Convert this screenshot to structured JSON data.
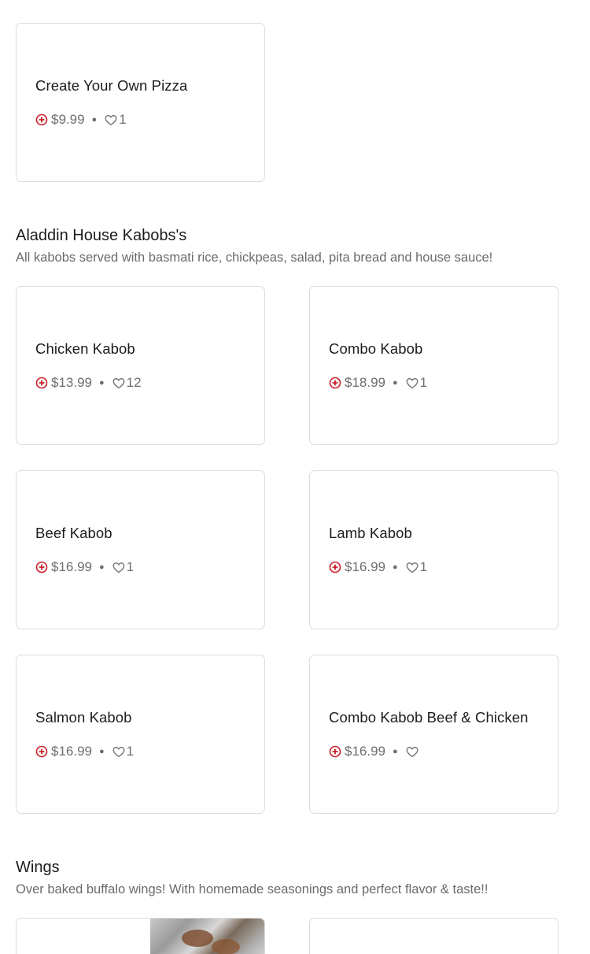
{
  "top_cut_text": "",
  "pizza_card": {
    "name": "Create Your Own Pizza",
    "price": "$9.99",
    "likes": "1"
  },
  "kabobs": {
    "title": "Aladdin House Kabobs's",
    "description": "All kabobs served with basmati rice, chickpeas, salad, pita bread and house sauce!",
    "items": [
      {
        "name": "Chicken Kabob",
        "price": "$13.99",
        "likes": "12"
      },
      {
        "name": "Combo Kabob",
        "price": "$18.99",
        "likes": "1"
      },
      {
        "name": "Beef Kabob",
        "price": "$16.99",
        "likes": "1"
      },
      {
        "name": "Lamb Kabob",
        "price": "$16.99",
        "likes": "1"
      },
      {
        "name": "Salmon Kabob",
        "price": "$16.99",
        "likes": "1"
      },
      {
        "name": "Combo Kabob Beef & Chicken",
        "price": "$16.99",
        "likes": ""
      }
    ]
  },
  "wings": {
    "title": "Wings",
    "description": "Over baked buffalo wings! With homemade seasonings and perfect flavor & taste!!"
  },
  "colors": {
    "accent": "#c8202a",
    "text": "#1c1c1c",
    "muted": "#6b6b6b",
    "border": "#dcdcdc"
  },
  "icons": {
    "add": "plus-circle-icon",
    "like": "heart-outline-icon"
  }
}
